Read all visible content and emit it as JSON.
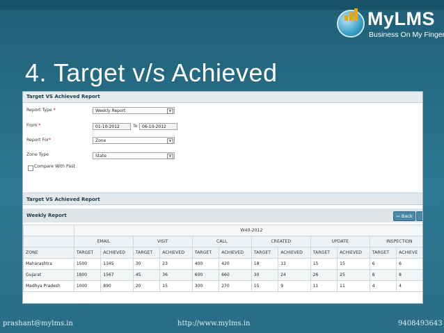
{
  "logo": {
    "name": "MyLMS",
    "tagline": "Business On My Finger Tips",
    "colors": {
      "accent": "#f2a400",
      "brand": "#3a9fc6"
    }
  },
  "slide_title": "4. Target v/s Achieved",
  "form": {
    "header": "Target VS Achieved Report",
    "report_type_label": "Report Type",
    "report_type_value": "Weekly Report",
    "from_label": "From",
    "from_value": "01-10-2012",
    "to_label": "To",
    "to_value": "06-10-2012",
    "report_for_label": "Report For",
    "report_for_value": "Zone",
    "zone_type_label": "Zone Type",
    "zone_type_value": "State",
    "compare_label": "Compare With Past"
  },
  "report": {
    "title": "Target VS Achieved Report",
    "subtitle": "Weekly Report",
    "back_label": "Back",
    "period": "W40-2012",
    "groups": [
      "EMAIL",
      "VISIT",
      "CALL",
      "CREATED",
      "UPDATE",
      "INSPECTION"
    ],
    "zone_header": "ZONE",
    "target_header": "TARGET",
    "achieved_header": "ACHIEVED",
    "achieved_header_cut": "ACHIEVE",
    "rows": [
      {
        "zone": "Maharashtra",
        "values": [
          "1500",
          "1345",
          "30",
          "23",
          "400",
          "420",
          "18",
          "13",
          "15",
          "15",
          "6",
          "6"
        ]
      },
      {
        "zone": "Gujarat",
        "values": [
          "1800",
          "1567",
          "45",
          "36",
          "600",
          "660",
          "30",
          "24",
          "26",
          "25",
          "8",
          "8"
        ]
      },
      {
        "zone": "Madhya Pradesh",
        "values": [
          "1000",
          "890",
          "20",
          "15",
          "300",
          "270",
          "15",
          "9",
          "11",
          "11",
          "4",
          "4"
        ]
      }
    ]
  },
  "footer": {
    "email": "prashant@mylms.in",
    "url": "http://www.mylms.in",
    "phone": "9408493643"
  }
}
